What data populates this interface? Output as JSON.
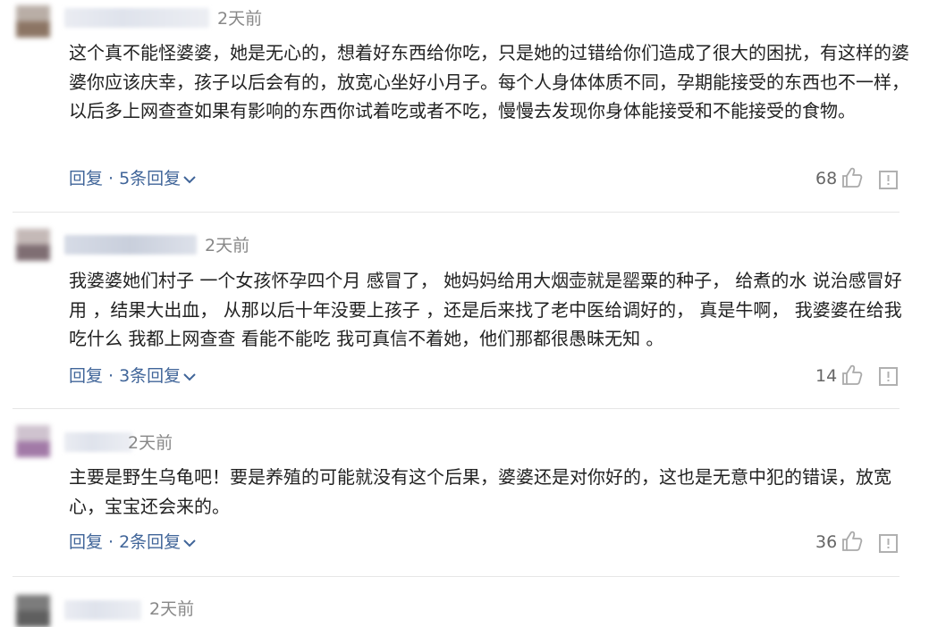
{
  "colors": {
    "link": "#406599",
    "text": "#222222",
    "meta": "#888888",
    "divider": "#e6e6e6"
  },
  "comments": [
    {
      "time": "2天前",
      "text": "这个真不能怪婆婆，她是无心的，想着好东西给你吃，只是她的过错给你们造成了很大的困扰，有这样的婆婆你应该庆幸，孩子以后会有的，放宽心坐好小月子。每个人身体体质不同，孕期能接受的东西也不一样，以后多上网查查如果有影响的东西你试着吃或者不吃，慢慢去发现你身体能接受和不能接受的食物。",
      "reply_label": "回复",
      "replies_label": "5条回复",
      "likes": "68"
    },
    {
      "time": "2天前",
      "text": "我婆婆她们村子 一个女孩怀孕四个月 感冒了， 她妈妈给用大烟壶就是罂粟的种子， 给煮的水 说治感冒好用 ，结果大出血， 从那以后十年没要上孩子 ，还是后来找了老中医给调好的， 真是牛啊， 我婆婆在给我吃什么 我都上网查查 看能不能吃 我可真信不着她，他们那都很愚昧无知 。",
      "reply_label": "回复",
      "replies_label": "3条回复",
      "likes": "14"
    },
    {
      "time": "2天前",
      "text": "主要是野生乌龟吧！要是养殖的可能就没有这个后果，婆婆还是对你好的，这也是无意中犯的错误，放宽心，宝宝还会来的。",
      "reply_label": "回复",
      "replies_label": "2条回复",
      "likes": "36"
    },
    {
      "time": "2天前"
    }
  ]
}
